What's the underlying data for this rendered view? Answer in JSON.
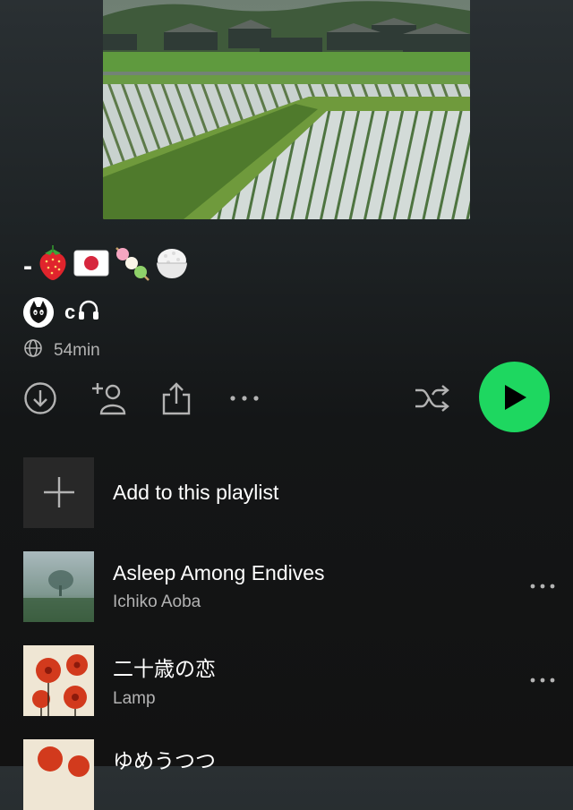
{
  "playlist": {
    "title_prefix": "-",
    "title_emojis": [
      "strawberry",
      "japan-flag",
      "dango",
      "rice-bowl"
    ],
    "owner": {
      "name": "c",
      "badge_icon": "headphones-icon"
    },
    "duration": "54min",
    "visibility_icon": "globe-icon"
  },
  "actions": {
    "download_icon": "download-icon",
    "add_user_icon": "add-user-icon",
    "share_icon": "share-icon",
    "more_icon": "more-icon",
    "shuffle_icon": "shuffle-icon",
    "play_icon": "play-icon"
  },
  "add_row": {
    "label": "Add to this playlist"
  },
  "tracks": [
    {
      "title": "Asleep Among Endives",
      "artist": "Ichiko Aoba"
    },
    {
      "title": "二十歳の恋",
      "artist": "Lamp"
    },
    {
      "title": "ゆめうつつ",
      "artist": ""
    }
  ],
  "colors": {
    "accent": "#1ed760",
    "background": "#121212",
    "secondary_text": "#b3b3b3"
  }
}
